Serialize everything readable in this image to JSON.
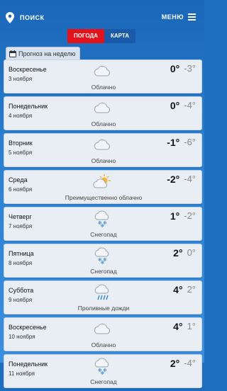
{
  "header": {
    "search_label": "ПОИСК",
    "menu_label": "МЕНЮ"
  },
  "tabs": [
    {
      "label": "ПОГОДА",
      "active": true
    },
    {
      "label": "КАРТА",
      "active": false
    }
  ],
  "section_title": "Прогноз на неделю",
  "colors": {
    "accent_red": "#e4121a",
    "header_blue": "#1a66b8"
  },
  "days": [
    {
      "name": "Воскресенье",
      "date": "3 ноября",
      "condition": "Облачно",
      "icon": "cloud-icon",
      "tmax": "0°",
      "tmin": "-3°"
    },
    {
      "name": "Понедельник",
      "date": "4 ноября",
      "condition": "Облачно",
      "icon": "cloud-icon",
      "tmax": "0°",
      "tmin": "-4°"
    },
    {
      "name": "Вторник",
      "date": "5 ноября",
      "condition": "Облачно",
      "icon": "cloud-icon",
      "tmax": "-1°",
      "tmin": "-6°"
    },
    {
      "name": "Среда",
      "date": "6 ноября",
      "condition": "Преимущественно облачно",
      "icon": "partly-cloudy-icon",
      "tmax": "-2°",
      "tmin": "-4°"
    },
    {
      "name": "Четверг",
      "date": "7 ноября",
      "condition": "Снегопад",
      "icon": "snow-icon",
      "tmax": "1°",
      "tmin": "-2°"
    },
    {
      "name": "Пятница",
      "date": "8 ноября",
      "condition": "Снегопад",
      "icon": "snow-icon",
      "tmax": "2°",
      "tmin": "0°"
    },
    {
      "name": "Суббота",
      "date": "9 ноября",
      "condition": "Проливные дожди",
      "icon": "rain-icon",
      "tmax": "4°",
      "tmin": "2°"
    },
    {
      "name": "Воскресенье",
      "date": "10 ноября",
      "condition": "Облачно",
      "icon": "cloud-icon",
      "tmax": "4°",
      "tmin": "1°"
    },
    {
      "name": "Понедельник",
      "date": "11 ноября",
      "condition": "Снегопад",
      "icon": "snow-icon",
      "tmax": "2°",
      "tmin": "-4°"
    }
  ]
}
